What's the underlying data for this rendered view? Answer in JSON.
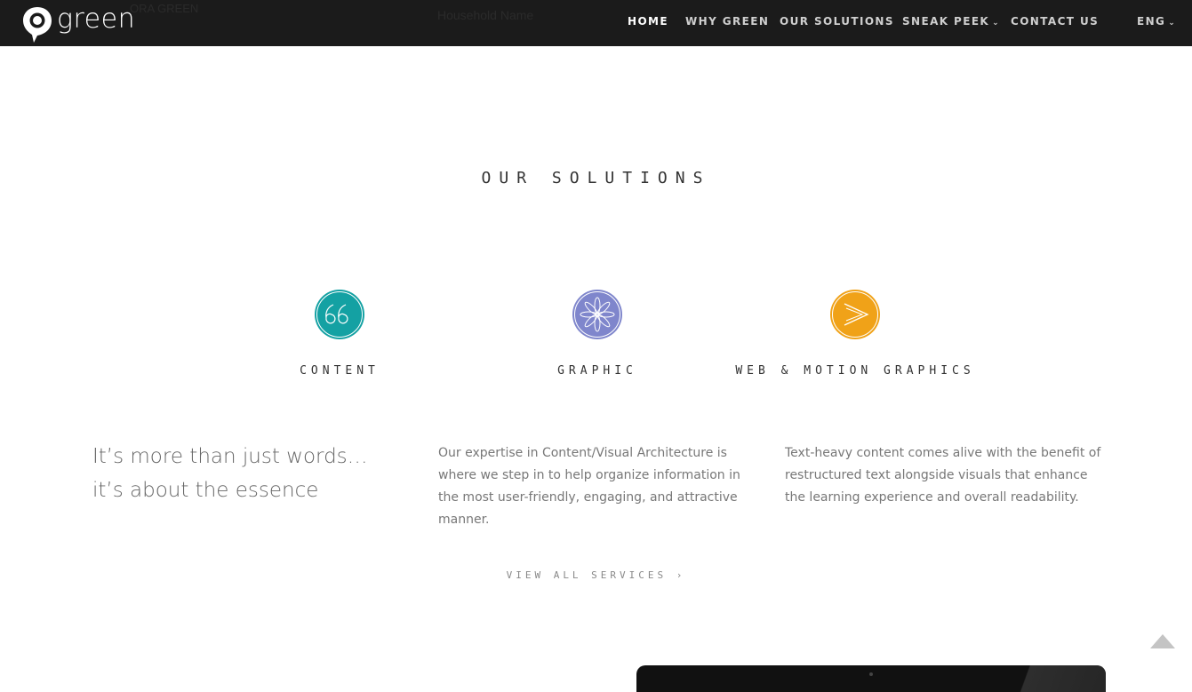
{
  "brand": {
    "name": "green"
  },
  "header_faded": {
    "left": "ORA GREEN",
    "center": "Household Name"
  },
  "nav": {
    "items": [
      {
        "label": "HOME",
        "active": true
      },
      {
        "label": "WHY GREEN"
      },
      {
        "label": "OUR SOLUTIONS"
      },
      {
        "label": "SNEAK PEEK",
        "dropdown": true
      },
      {
        "label": "CONTACT US"
      }
    ],
    "language": "ENG"
  },
  "section": {
    "title": "OUR SOLUTIONS"
  },
  "solutions": [
    {
      "label": "CONTENT",
      "icon": "quote-icon",
      "color": "#14a1a3"
    },
    {
      "label": "GRAPHIC",
      "icon": "flower-icon",
      "color": "#7f86cc"
    },
    {
      "label": "WEB & MOTION GRAPHICS",
      "icon": "chevron-right-icon",
      "color": "#f0a218"
    }
  ],
  "tagline": {
    "line1": "It’s more than just words…",
    "line2": "it’s about the essence"
  },
  "descriptions": [
    "Our expertise in Content/Visual Architecture is where we step in to help organize information in the most user-friendly, engaging, and attractive manner.",
    "Text-heavy content comes alive with the benefit of restructured text alongside visuals that enhance the learning experience and overall readability."
  ],
  "cta": {
    "view_all": "VIEW ALL SERVICES  ›"
  }
}
